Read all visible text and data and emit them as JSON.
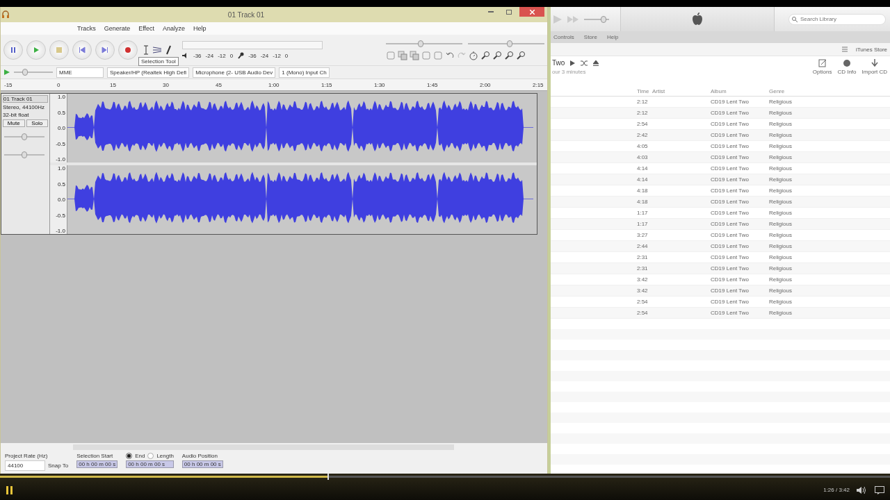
{
  "audacity": {
    "title": "01 Track 01",
    "menu": [
      "Tracks",
      "Generate",
      "Effect",
      "Analyze",
      "Help"
    ],
    "tooltip": "Selection Tool",
    "playback_ticks": [
      "-36",
      "-24",
      "-12",
      "0"
    ],
    "record_ticks": [
      "-36",
      "-24",
      "-12",
      "0"
    ],
    "playback_volume": {
      "level": 0.45
    },
    "record_volume": {
      "level": 0.55
    },
    "speed": {
      "level": 0.25
    },
    "devices": {
      "host": "MME",
      "output": "Speaker/HP (Realtek High Defi",
      "input": "Microphone (2- USB Audio Dev",
      "channels": "1 (Mono) Input Ch"
    },
    "ruler": [
      "-15",
      "0",
      "15",
      "30",
      "45",
      "1:00",
      "1:15",
      "1:30",
      "1:45",
      "2:00",
      "2:15"
    ],
    "track": {
      "name": "01 Track 01",
      "info": [
        "Stereo, 44100Hz",
        "32-bit float"
      ],
      "buttons": [
        "Mute",
        "Solo"
      ],
      "gain": {
        "level": 0.5
      },
      "pan": {
        "level": 0.5
      },
      "channels": [
        {
          "scale": [
            "1.0",
            "0.5",
            "0.0",
            "-0.5",
            "-1.0"
          ]
        },
        {
          "scale": [
            "1.0",
            "0.5",
            "0.0",
            "-0.5",
            "-1.0"
          ]
        }
      ]
    },
    "selection_bar": {
      "rate_label": "Project Rate (Hz)",
      "rate": "44100",
      "snap_label": "Snap To",
      "start_label": "Selection Start",
      "options": [
        {
          "label": "End",
          "selected": true
        },
        {
          "label": "Length",
          "selected": false
        }
      ],
      "position_label": "Audio Position",
      "times": [
        "00 h 00 m 00 s",
        "00 h 00 m 00 s",
        "00 h 00 m 00 s"
      ]
    }
  },
  "itunes": {
    "volume": {
      "level": 0.85
    },
    "search": {
      "placeholder": "Search Library"
    },
    "menu": [
      "Controls",
      "Store",
      "Help"
    ],
    "store_button": "iTunes Store",
    "album_title": "Two",
    "album_subtitle": "our 3 minutes",
    "actions": [
      "Options",
      "CD Info",
      "Import CD"
    ],
    "columns": [
      "Time",
      "Artist",
      "Album",
      "Genre"
    ],
    "rows": [
      {
        "time": "2:12",
        "album": "CD19 Lent Two",
        "genre": "Religious"
      },
      {
        "time": "2:12",
        "album": "CD19 Lent Two",
        "genre": "Religious"
      },
      {
        "time": "2:54",
        "album": "CD19 Lent Two",
        "genre": "Religious"
      },
      {
        "time": "2:42",
        "album": "CD19 Lent Two",
        "genre": "Religious"
      },
      {
        "time": "4:05",
        "album": "CD19 Lent Two",
        "genre": "Religious"
      },
      {
        "time": "4:03",
        "album": "CD19 Lent Two",
        "genre": "Religious"
      },
      {
        "time": "4:14",
        "album": "CD19 Lent Two",
        "genre": "Religious"
      },
      {
        "time": "4:14",
        "album": "CD19 Lent Two",
        "genre": "Religious"
      },
      {
        "time": "4:18",
        "album": "CD19 Lent Two",
        "genre": "Religious"
      },
      {
        "time": "4:18",
        "album": "CD19 Lent Two",
        "genre": "Religious"
      },
      {
        "time": "1:17",
        "album": "CD19 Lent Two",
        "genre": "Religious"
      },
      {
        "time": "1:17",
        "album": "CD19 Lent Two",
        "genre": "Religious"
      },
      {
        "time": "3:27",
        "album": "CD19 Lent Two",
        "genre": "Religious"
      },
      {
        "time": "2:44",
        "album": "CD19 Lent Two",
        "genre": "Religious"
      },
      {
        "time": "2:31",
        "album": "CD19 Lent Two",
        "genre": "Religious"
      },
      {
        "time": "2:31",
        "album": "CD19 Lent Two",
        "genre": "Religious"
      },
      {
        "time": "3:42",
        "album": "CD19 Lent Two",
        "genre": "Religious"
      },
      {
        "time": "3:42",
        "album": "CD19 Lent Two",
        "genre": "Religious"
      },
      {
        "time": "2:54",
        "album": "CD19 Lent Two",
        "genre": "Religious"
      },
      {
        "time": "2:54",
        "album": "CD19 Lent Two",
        "genre": "Religious"
      }
    ]
  },
  "player": {
    "level": 0.368,
    "time": "1:26 / 3:42"
  }
}
